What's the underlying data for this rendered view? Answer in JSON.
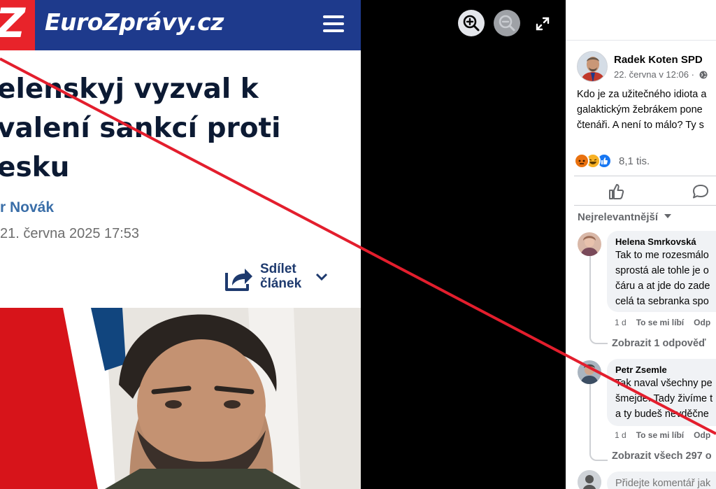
{
  "article": {
    "site_name": "EuroZprávy.cz",
    "title_lines": [
      "elenskyj vyzval k",
      "valení sankcí proti",
      "esku"
    ],
    "author": "r Novák",
    "date": "21. června 2025 17:53",
    "share_line1": "Sdílet",
    "share_line2": "článek"
  },
  "lightbox": {
    "zoom_in": "zoom-in",
    "zoom_out": "zoom-out",
    "fullscreen": "fullscreen"
  },
  "post": {
    "author": "Radek Koten SPD",
    "time": "22. června v 12:06 ·",
    "text_lines": [
      "Kdo je za užitečného idiota a",
      "galaktickým žebrákem pone",
      "čtenáři. A není to málo? Ty s"
    ],
    "reaction_count": "8,1 tis.",
    "sort_label": "Nejrelevantnější"
  },
  "comments": [
    {
      "name": "Helena Smrkovská",
      "lines": [
        "Tak to me rozesmálo",
        "sprostá ale tohle je o",
        "čáru a at jde do zade",
        "celá ta sebranka spo"
      ],
      "age": "1 d",
      "like": "To se mi líbí",
      "reply": "Odp",
      "view_replies": "Zobrazit 1 odpověď"
    },
    {
      "name": "Petr Zsemle",
      "lines": [
        "Tak naval všechny pe",
        "šmejde. Tady živíme t",
        "a ty budeš nevděčne"
      ],
      "age": "1 d",
      "like": "To se mi líbí",
      "reply": "Odp",
      "view_replies": "Zobrazit všech 297 o"
    }
  ],
  "composer": {
    "placeholder": "Přidejte komentář jak"
  },
  "colors": {
    "site_blue": "#1e3a8c",
    "site_red": "#e8232a",
    "strike_red": "#e31e2d"
  }
}
